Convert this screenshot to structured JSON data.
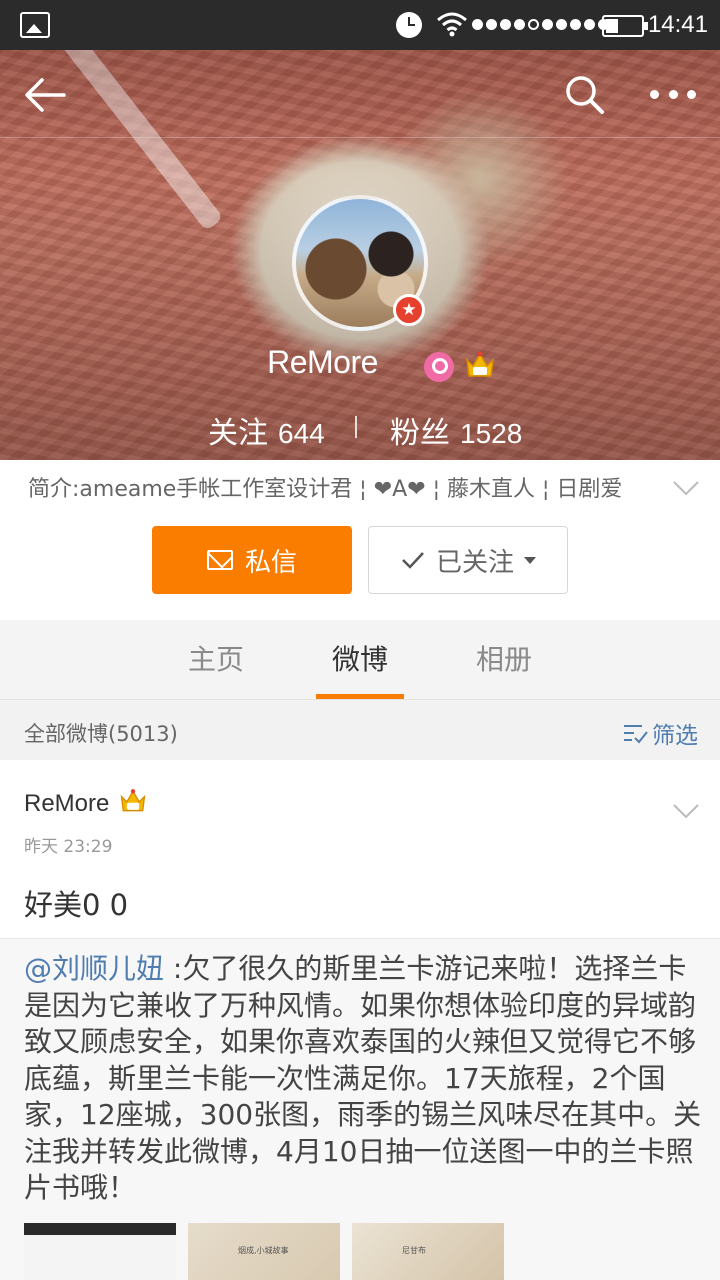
{
  "status_bar": {
    "time": "14:41"
  },
  "profile": {
    "username": "ReMore",
    "following_label": "关注",
    "following_count": "644",
    "followers_label": "粉丝",
    "followers_count": "1528",
    "intro": "简介:ameame手帐工作室设计君 ¦ ❤A❤ ¦ 藤木直人 ¦ 日剧爱",
    "badge_colors": {
      "verified": "#e6412e",
      "female": "#f06aa6",
      "crown": "#f5b800"
    }
  },
  "actions": {
    "message_label": "私信",
    "followed_label": "已关注",
    "accent_color": "#fa7d00"
  },
  "tabs": [
    {
      "label": "主页",
      "active": false
    },
    {
      "label": "微博",
      "active": true
    },
    {
      "label": "相册",
      "active": false
    }
  ],
  "feed": {
    "count_label": "全部微博(5013)",
    "filter_label": "筛选"
  },
  "post": {
    "author": "ReMore",
    "time": "昨天 23:29",
    "text": "好美0 0",
    "repost": {
      "mention": "@刘顺儿妞",
      "text": " :欠了很久的斯里兰卡游记来啦！选择兰卡是因为它兼收了万种风情。如果你想体验印度的异域韵致又顾虑安全，如果你喜欢泰国的火辣但又觉得它不够底蕴，斯里兰卡能一次性满足你。17天旅程，2个国家，12座城，300张图，雨季的锡兰风味尽在其中。关注我并转发此微博，4月10日抽一位送图一中的兰卡照片书哦！",
      "thumbs": [
        {
          "caption": ""
        },
        {
          "caption": "烟成,小城故事"
        },
        {
          "caption": "尼甘布"
        }
      ]
    }
  }
}
